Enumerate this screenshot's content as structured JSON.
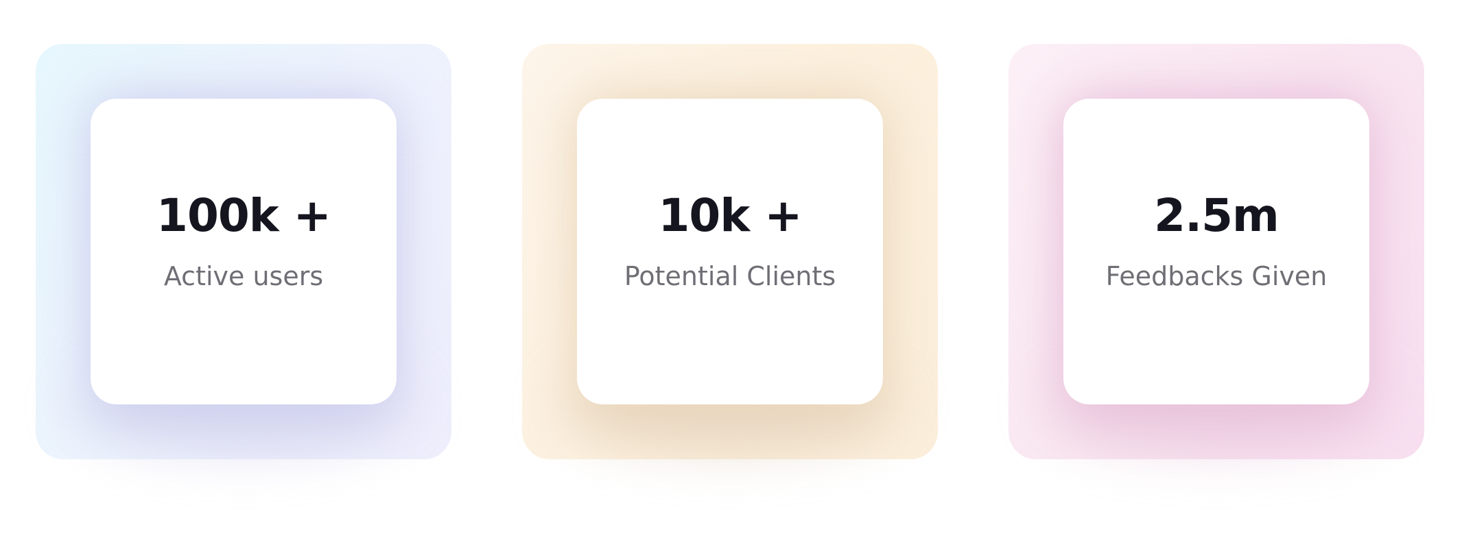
{
  "stats": [
    {
      "value": "100k +",
      "label": "Active users"
    },
    {
      "value": "10k +",
      "label": "Potential Clients"
    },
    {
      "value": "2.5m",
      "label": "Feedbacks Given"
    }
  ],
  "colors": {
    "value_text": "#15151f",
    "label_text": "#6e6e75",
    "card_1_tint": "#eef3fd",
    "card_2_tint": "#fcf0de",
    "card_3_tint": "#f9e6f1"
  }
}
